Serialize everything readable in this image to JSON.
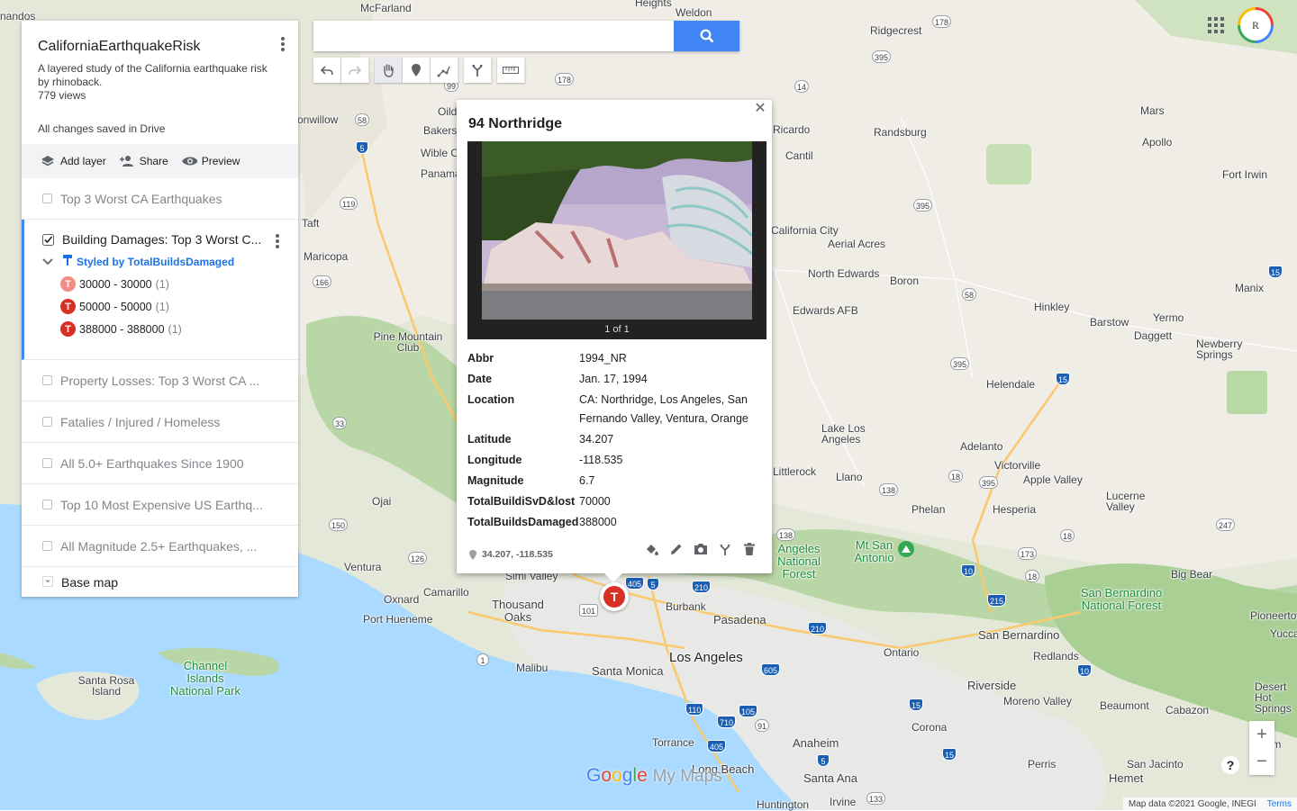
{
  "map": {
    "cities": [
      "McFarland",
      "Weldon",
      "Ridgecrest",
      "Bakersfield",
      "Wible O",
      "Panama",
      "Oildale",
      "Taft",
      "Maricopa",
      "Ricardo",
      "Randsburg",
      "Cantil",
      "Mars",
      "Apollo",
      "Fort Irwin",
      "California City",
      "Aerial Acres",
      "North Edwards",
      "Boron",
      "Edwards AFB",
      "Hinkley",
      "Barstow",
      "Yermo",
      "Daggett",
      "Manix",
      "Newberry Springs",
      "Helendale",
      "Adelanto",
      "Lake Los Angeles",
      "Llano",
      "Littlerock",
      "Victorville",
      "Apple Valley",
      "Phelan",
      "Hesperia",
      "Lucerne Valley",
      "Ojai",
      "Ventura",
      "Camarillo",
      "Oxnard",
      "Thousand Oaks",
      "Port Hueneme",
      "Simi Valley",
      "Burbank",
      "Pasadena",
      "Los Angeles",
      "Santa Monica",
      "Malibu",
      "Ontario",
      "San Bernardino",
      "Redlands",
      "Riverside",
      "Moreno Valley",
      "Beaumont",
      "Cabazon",
      "Corona",
      "Anaheim",
      "Torrance",
      "Long Beach",
      "Santa Ana",
      "Irvine",
      "Huntington",
      "Perris",
      "Hemet",
      "San Jacinto",
      "Big Bear",
      "Pioneertown",
      "Yucca",
      "Desert Hot Springs",
      "Palm",
      "Santa Rosa Island",
      "Pine Mountain Club",
      "nandos",
      "onwillow",
      "Heights"
    ],
    "parks": [
      "Channel Islands National Park",
      "Angeles National Forest",
      "San Bernardino National Forest",
      "Mt San Antonio"
    ],
    "shields": [
      "178",
      "99",
      "58",
      "5",
      "178",
      "14",
      "395",
      "395",
      "119",
      "166",
      "33",
      "138",
      "58",
      "395",
      "15",
      "15",
      "138",
      "18",
      "395",
      "247",
      "150",
      "126",
      "101",
      "5",
      "405",
      "210",
      "210",
      "1",
      "605",
      "10",
      "110",
      "710",
      "105",
      "91",
      "405",
      "5",
      "15",
      "215",
      "10",
      "18",
      "173",
      "18",
      "15",
      "133",
      "178",
      "247"
    ]
  },
  "panel": {
    "title": "CaliforniaEarthquakeRisk",
    "description": "A layered study of the California earthquake risk by rhinoback.",
    "views": "779 views",
    "saved": "All changes saved in Drive",
    "actions": {
      "add_layer": "Add layer",
      "share": "Share",
      "preview": "Preview"
    },
    "layers": [
      {
        "label": "Top 3 Worst CA Earthquakes",
        "checked": false
      },
      {
        "label": "Building Damages: Top 3 Worst C...",
        "checked": true
      },
      {
        "label": "Property Losses: Top 3 Worst CA ...",
        "checked": false
      },
      {
        "label": "Fatalies / Injured / Homeless",
        "checked": false
      },
      {
        "label": "All 5.0+ Earthquakes Since 1900",
        "checked": false
      },
      {
        "label": "Top 10 Most Expensive US Earthq...",
        "checked": false
      },
      {
        "label": "All Magnitude 2.5+ Earthquakes, ...",
        "checked": false
      }
    ],
    "styled_by": "Styled by TotalBuildsDamaged",
    "legend": [
      {
        "range": "30000 - 30000",
        "count": "(1)"
      },
      {
        "range": "50000 - 50000",
        "count": "(1)"
      },
      {
        "range": "388000 - 388000",
        "count": "(1)"
      }
    ],
    "base_map": "Base map"
  },
  "search": {
    "value": "",
    "placeholder": ""
  },
  "popup": {
    "title": "94 Northridge",
    "photo_count": "1 of 1",
    "properties": [
      {
        "key": "Abbr",
        "value": "1994_NR"
      },
      {
        "key": "Date",
        "value": "Jan. 17, 1994"
      },
      {
        "key": "Location",
        "value": "CA: Northridge, Los Angeles, San Fernando Valley, Ventura, Orange"
      },
      {
        "key": "Latitude",
        "value": "34.207"
      },
      {
        "key": "Longitude",
        "value": "-118.535"
      },
      {
        "key": "Magnitude",
        "value": "6.7"
      },
      {
        "key": "TotalBuildiSvD&lost",
        "value": "70000"
      },
      {
        "key": "TotalBuildsDamaged",
        "value": "388000"
      }
    ],
    "coords": "34.207, -118.535"
  },
  "marker_letter": "T",
  "account": {
    "initial": "R"
  },
  "zoom": {
    "in": "+",
    "out": "−"
  },
  "help": "?",
  "logo": {
    "google": "Google",
    "mymaps": "My Maps"
  },
  "attribution": {
    "text": "Map data ©2021 Google, INEGI",
    "terms": "Terms"
  },
  "colors": {
    "accent": "#4285f4",
    "marker": "#d93025",
    "marker_light": "#f28b82",
    "water": "#aadaff",
    "land": "#f1efe9"
  }
}
